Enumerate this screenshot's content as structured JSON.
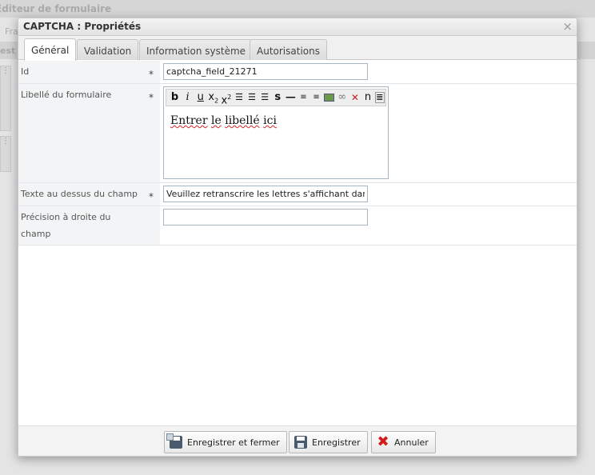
{
  "background": {
    "app_title": "Éditeur de formulaire",
    "toolbar_text": "Fra",
    "strip_text": "est"
  },
  "dialog": {
    "title": "CAPTCHA : Propriétés",
    "close_label": "×",
    "tabs": [
      {
        "label": "Général",
        "active": true
      },
      {
        "label": "Validation",
        "active": false
      },
      {
        "label": "Information système",
        "active": false
      },
      {
        "label": "Autorisations",
        "active": false
      }
    ],
    "fields": {
      "id": {
        "label": "Id",
        "required_mark": "*",
        "value": "captcha_field_21271"
      },
      "form_label": {
        "label": "Libellé du formulaire",
        "required_mark": "*",
        "editor_text": "Entrer le libellé ici"
      },
      "text_above": {
        "label": "Texte au dessus du champ",
        "required_mark": "*",
        "value": "Veuillez retranscrire les lettres s'affichant dans l'image"
      },
      "precision_right": {
        "label": "Précision à droite du champ",
        "value": ""
      }
    },
    "editor_toolbar": [
      "bold-icon",
      "italic-icon",
      "underline-icon",
      "subscript-icon",
      "superscript-icon",
      "align-left-icon",
      "align-justify-icon",
      "align-right-icon",
      "strikethrough-icon",
      "horizontal-rule-icon",
      "ordered-list-icon",
      "unordered-list-icon",
      "image-icon",
      "link-icon",
      "unlink-icon",
      "special-char-icon",
      "source-icon"
    ],
    "footer": {
      "save_close": "Enregistrer et fermer",
      "save": "Enregistrer",
      "cancel": "Annuler"
    }
  },
  "colors": {
    "cancel_icon": "#d21b1b",
    "label_bg": "#f2f4f5",
    "input_border": "#a9b6c1"
  }
}
